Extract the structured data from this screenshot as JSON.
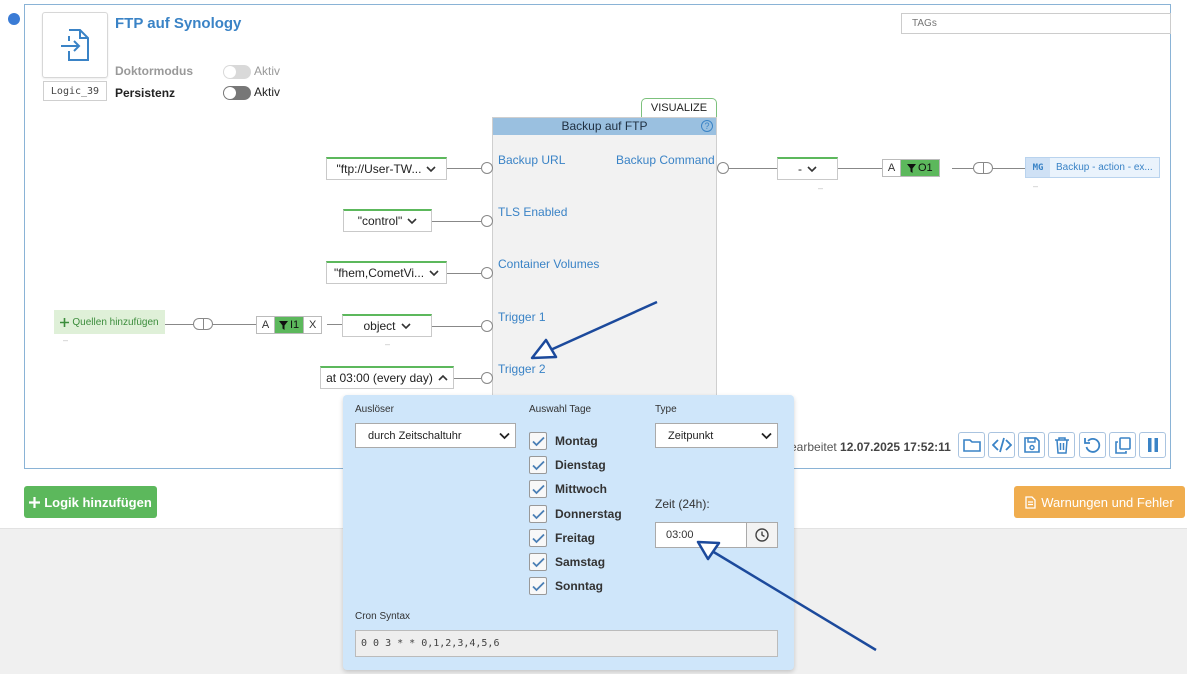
{
  "logic": {
    "title": "FTP auf Synology",
    "id": "Logic_39",
    "tags_placeholder": "TAGs",
    "doktormodus_label": "Doktormodus",
    "doktormodus_toggle": "Aktiv",
    "persistenz_label": "Persistenz",
    "persistenz_toggle": "Aktiv"
  },
  "block": {
    "title": "Backup auf FTP",
    "help": "?",
    "visualize_label": "VISUALIZE",
    "inputs": [
      "Backup URL",
      "TLS Enabled",
      "Container Volumes",
      "Trigger 1",
      "Trigger 2"
    ],
    "outputs": [
      "Backup Command"
    ]
  },
  "input_values": {
    "backup_url": "\"ftp://User-TW...",
    "tls_enabled": "\"control\"",
    "container_volumes": "\"fhem,CometVi...",
    "trigger1": "object",
    "trigger2": "at 03:00 (every day)"
  },
  "sources": {
    "add_label": "Quellen hinzufügen",
    "link_a": "A",
    "link_i1": "I1",
    "link_x": "X"
  },
  "output": {
    "value": "-",
    "link_a": "A",
    "link_o1": "O1",
    "mg_badge": "MG",
    "mg_text": "Backup - action - ex..."
  },
  "dashes": {
    "d1": "–",
    "d2": "–",
    "d3": "–",
    "d4": "–"
  },
  "footer": {
    "edited_prefix": "earbeitet",
    "edited_time": "12.07.2025 17:52:11",
    "add_logic": "Logik hinzufügen",
    "warnings": "Warnungen und Fehler"
  },
  "schedule": {
    "trigger_label": "Auslöser",
    "trigger_value": "durch Zeitschaltuhr",
    "days_label": "Auswahl Tage",
    "days": [
      "Montag",
      "Dienstag",
      "Mittwoch",
      "Donnerstag",
      "Freitag",
      "Samstag",
      "Sonntag"
    ],
    "days_checked": [
      true,
      true,
      true,
      true,
      true,
      true,
      true
    ],
    "type_label": "Type",
    "type_value": "Zeitpunkt",
    "time_label": "Zeit (24h):",
    "time_value": "03:00",
    "cron_label": "Cron Syntax",
    "cron_value": "0 0 3 * * 0,1,2,3,4,5,6"
  },
  "colors": {
    "accent_blue": "#3a83c6",
    "green": "#5cb85c",
    "orange": "#f0ad4e",
    "popup_bg": "#cfe6fa",
    "annotation_arrow": "#1c4a9c"
  },
  "icons": [
    "import-file-icon",
    "chevron-down-icon",
    "help-icon",
    "plus-icon",
    "filter-icon",
    "folder-icon",
    "code-icon",
    "save-icon",
    "trash-icon",
    "undo-icon",
    "copy-icon",
    "pause-icon",
    "clock-icon",
    "document-icon",
    "check-icon"
  ]
}
